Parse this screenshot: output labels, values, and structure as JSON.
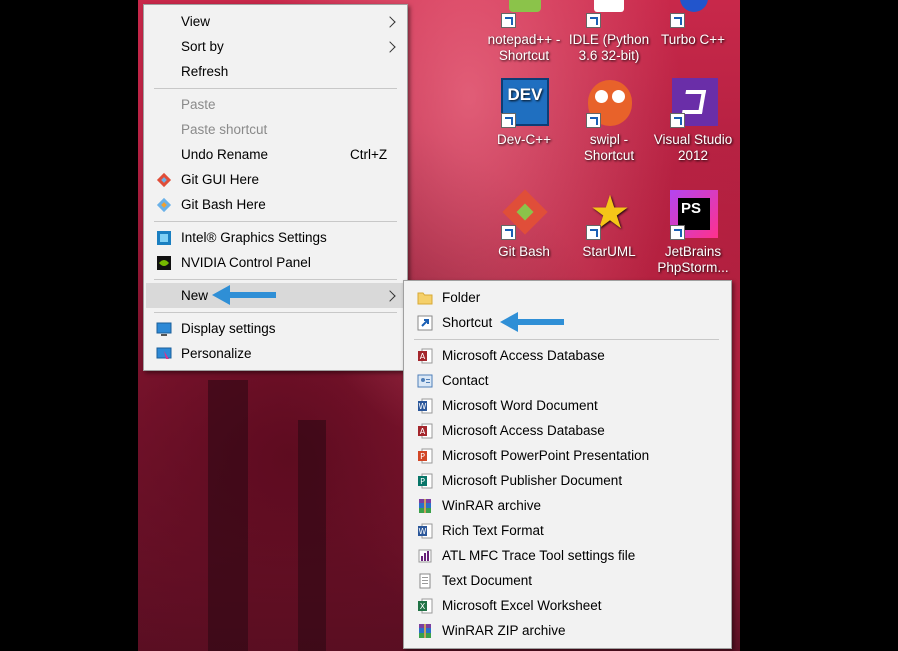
{
  "context_menu": {
    "items": [
      {
        "label": "View",
        "has_submenu": true
      },
      {
        "label": "Sort by",
        "has_submenu": true
      },
      {
        "label": "Refresh"
      },
      {
        "label": "Paste",
        "disabled": true
      },
      {
        "label": "Paste shortcut",
        "disabled": true
      },
      {
        "label": "Undo Rename",
        "shortcut": "Ctrl+Z"
      },
      {
        "label": "Git GUI Here",
        "icon": "git-gui-icon"
      },
      {
        "label": "Git Bash Here",
        "icon": "git-bash-icon"
      },
      {
        "label": "Intel® Graphics Settings",
        "icon": "intel-graphics-icon"
      },
      {
        "label": "NVIDIA Control Panel",
        "icon": "nvidia-icon"
      },
      {
        "label": "New",
        "has_submenu": true,
        "highlighted": true
      },
      {
        "label": "Display settings",
        "icon": "display-icon"
      },
      {
        "label": "Personalize",
        "icon": "personalize-icon"
      }
    ]
  },
  "new_submenu": {
    "items": [
      {
        "label": "Folder",
        "icon": "folder-icon"
      },
      {
        "label": "Shortcut",
        "icon": "shortcut-icon"
      },
      {
        "label": "Microsoft Access Database",
        "icon": "access-icon"
      },
      {
        "label": "Contact",
        "icon": "contact-icon"
      },
      {
        "label": "Microsoft Word Document",
        "icon": "word-icon"
      },
      {
        "label": "Microsoft Access Database",
        "icon": "access-icon"
      },
      {
        "label": "Microsoft PowerPoint Presentation",
        "icon": "powerpoint-icon"
      },
      {
        "label": "Microsoft Publisher Document",
        "icon": "publisher-icon"
      },
      {
        "label": "WinRAR archive",
        "icon": "winrar-icon"
      },
      {
        "label": "Rich Text Format",
        "icon": "rtf-icon"
      },
      {
        "label": "ATL MFC Trace Tool settings file",
        "icon": "trace-tool-icon"
      },
      {
        "label": "Text Document",
        "icon": "text-document-icon"
      },
      {
        "label": "Microsoft Excel Worksheet",
        "icon": "excel-icon"
      },
      {
        "label": "WinRAR ZIP archive",
        "icon": "winrar-zip-icon"
      }
    ]
  },
  "desktop_icons": [
    {
      "line1": "notepad++ -",
      "line2": "Shortcut",
      "icon": "notepadpp-icon"
    },
    {
      "line1": "IDLE (Python",
      "line2": "3.6 32-bit)",
      "icon": "python-idle-icon"
    },
    {
      "line1": "Turbo C++",
      "line2": "",
      "icon": "turbo-cpp-icon"
    },
    {
      "line1": "Dev-C++",
      "line2": "",
      "icon": "dev-cpp-icon",
      "badge": "DEV"
    },
    {
      "line1": "swipl -",
      "line2": "Shortcut",
      "icon": "swipl-icon"
    },
    {
      "line1": "Visual Studio",
      "line2": "2012",
      "icon": "visual-studio-icon"
    },
    {
      "line1": "Git Bash",
      "line2": "",
      "icon": "git-bash-desktop-icon"
    },
    {
      "line1": "StarUML",
      "line2": "",
      "icon": "staruml-icon"
    },
    {
      "line1": "JetBrains",
      "line2": "PhpStorm...",
      "icon": "phpstorm-icon",
      "badge": "PS"
    }
  ],
  "colors": {
    "menu_bg": "#f2f2f2",
    "highlight": "#d9d9d9",
    "annotation_arrow": "#2f8fd6"
  }
}
